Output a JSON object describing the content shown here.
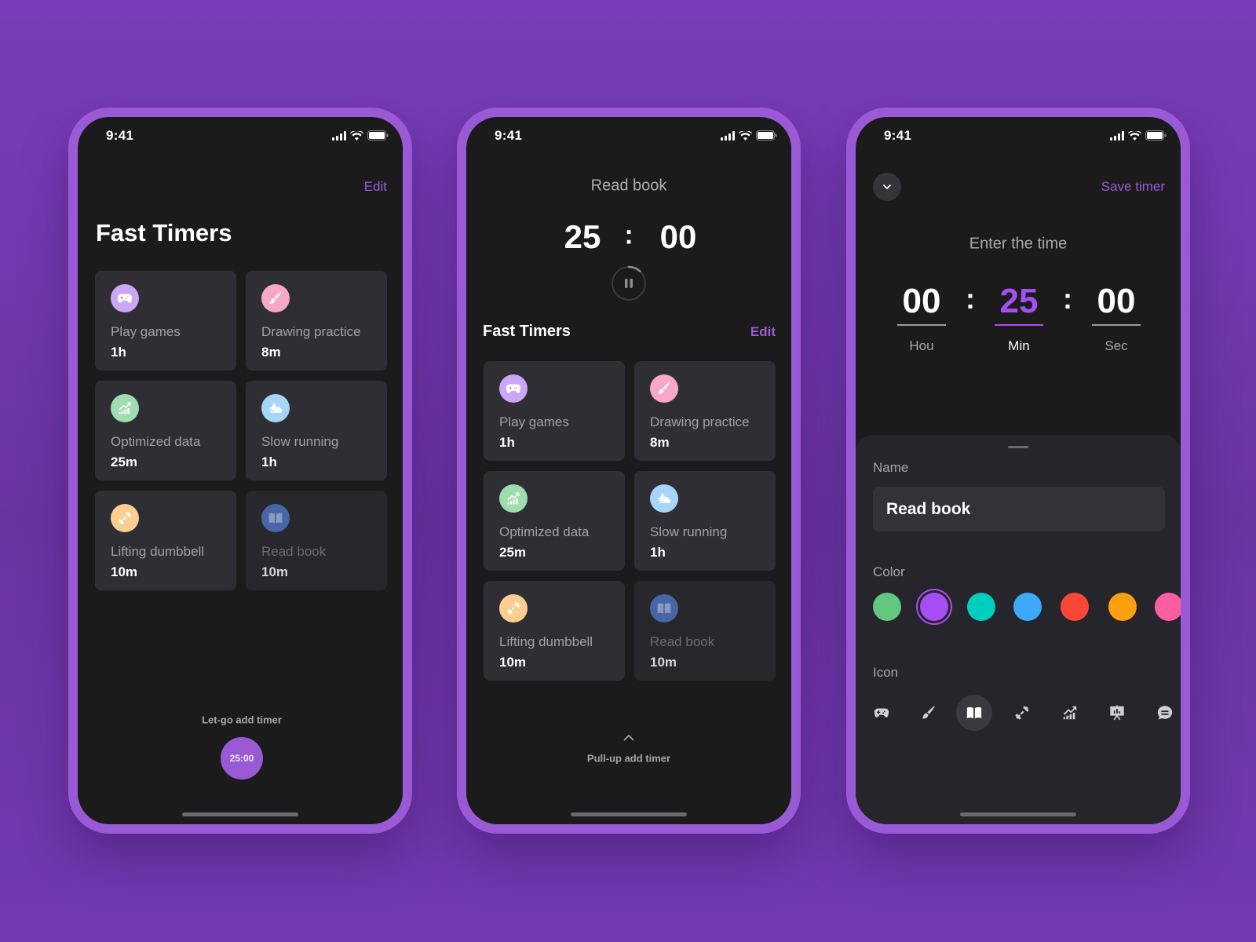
{
  "status_bar": {
    "time": "9:41",
    "icons": [
      "signal-icon",
      "wifi-icon",
      "battery-icon"
    ]
  },
  "colors": {
    "accent": "#9d5ad9",
    "background": "#7a3cba",
    "screen": "#1b1b1c",
    "card": "#302e35"
  },
  "timers": [
    {
      "label": "Play games",
      "value": "1h",
      "icon": "gamepad-icon",
      "color": "#c9a7f5"
    },
    {
      "label": "Drawing practice",
      "value": "8m",
      "icon": "brush-icon",
      "color": "#f7a8c9"
    },
    {
      "label": "Optimized data",
      "value": "25m",
      "icon": "chart-icon",
      "color": "#9fdcb0"
    },
    {
      "label": "Slow running",
      "value": "1h",
      "icon": "shoe-icon",
      "color": "#a5d6f7"
    },
    {
      "label": "Lifting dumbbell",
      "value": "10m",
      "icon": "dumbbell-icon",
      "color": "#fcce8f"
    },
    {
      "label": "Read book",
      "value": "10m",
      "icon": "book-icon",
      "color": "#4766a8"
    }
  ],
  "screen1": {
    "edit_label": "Edit",
    "title": "Fast Timers",
    "hint": "Let-go add timer",
    "drag_timer": "25:00"
  },
  "screen2": {
    "timer_name": "Read book",
    "minutes": "25",
    "separator": ":",
    "seconds": "00",
    "progress": 0.12,
    "section_title": "Fast Timers",
    "edit_label": "Edit",
    "hint": "Pull-up add timer"
  },
  "screen3": {
    "save_label": "Save timer",
    "prompt": "Enter the time",
    "time": {
      "hours": "00",
      "minutes": "25",
      "seconds": "00",
      "separator": ":",
      "hours_label": "Hou",
      "minutes_label": "Min",
      "seconds_label": "Sec",
      "active": "minutes"
    },
    "name_label": "Name",
    "name_value": "Read book",
    "color_label": "Color",
    "color_options": [
      "#63c77f",
      "#a64ef3",
      "#00cdbd",
      "#3ea9fb",
      "#fb4734",
      "#fc9f11",
      "#fc5fa1"
    ],
    "selected_color": 1,
    "icon_label": "Icon",
    "icon_options": [
      "gamepad-icon",
      "brush-icon",
      "book-icon",
      "dumbbell-icon",
      "chart-icon",
      "presentation-icon",
      "chat-icon"
    ],
    "selected_icon": 2
  }
}
